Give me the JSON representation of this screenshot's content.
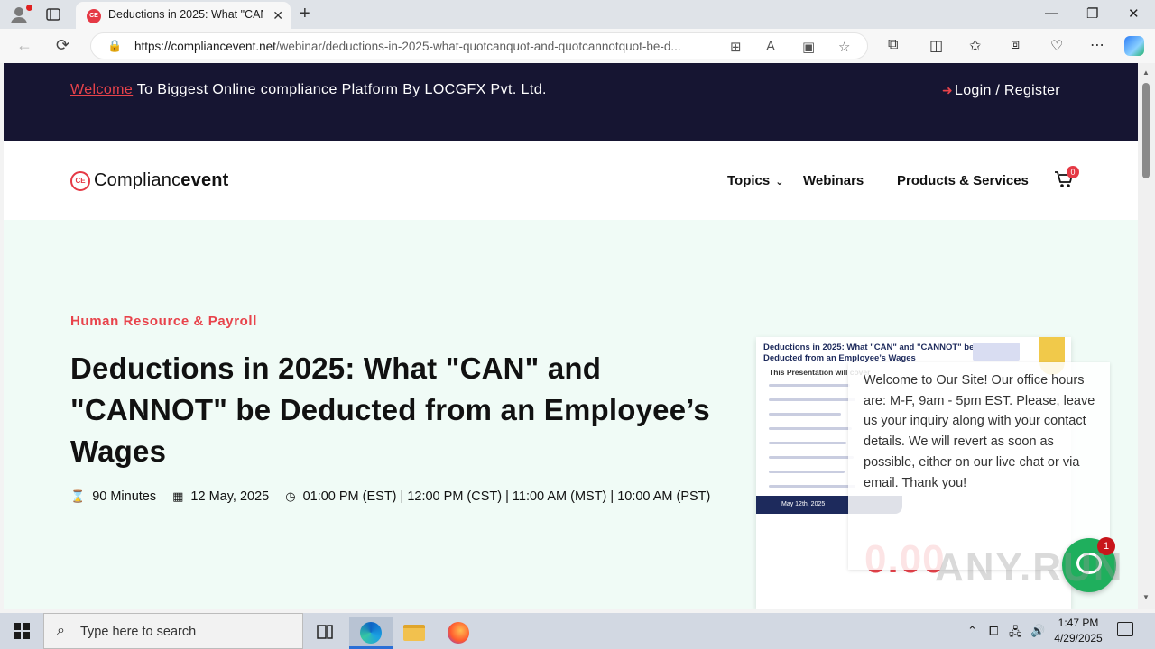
{
  "browser": {
    "tab_title": "Deductions in 2025: What \"CAN\"",
    "tab_close": "✕",
    "new_tab": "+",
    "url_domain": "https://compliancevent.net",
    "url_path": "/webinar/deductions-in-2025-what-quotcanquot-and-quotcannotquot-be-d...",
    "window_controls": {
      "minimize": "—",
      "restore": "❐",
      "close": "✕"
    }
  },
  "topbar": {
    "welcome_link": "Welcome",
    "welcome_text": " To Biggest Online compliance Platform By LOCGFX Pvt. Ltd.",
    "login_label": "Login / Register"
  },
  "header": {
    "logo_light": "Complianc",
    "logo_bold": "event",
    "logo_mark": "CE",
    "nav": [
      {
        "label": "Topics"
      },
      {
        "label": "Webinars"
      },
      {
        "label": "Products & Services"
      }
    ],
    "cart_count": "0"
  },
  "hero": {
    "category": "Human Resource & Payroll",
    "title": "Deductions in 2025: What \"CAN\" and \"CANNOT\" be Deducted from an Employee’s Wages",
    "duration": "90 Minutes",
    "date": "12 May, 2025",
    "time": "01:00 PM (EST) | 12:00 PM (CST) | 11:00 AM (MST) | 10:00 AM (PST)"
  },
  "promo": {
    "title": "Deductions in 2025: What \"CAN\" and \"CANNOT\" be Deducted from an Employee’s Wages",
    "subtitle": "This Presentation will cover",
    "date_strip": "May 12th, 2025",
    "price": "0.00"
  },
  "chat": {
    "message": "Welcome to Our Site! Our office hours are: M-F, 9am - 5pm EST. Please, leave us your inquiry along with your contact details. We will revert as soon as possible, either on our live chat or via email. Thank you!",
    "badge": "1"
  },
  "watermark": "ANY.RUN",
  "taskbar": {
    "search_placeholder": "Type here to search",
    "time": "1:47 PM",
    "date": "4/29/2025"
  },
  "colors": {
    "accent": "#e8434b",
    "topbar_bg": "#161532",
    "hero_bg": "#f0fbf6",
    "chat_green": "#1faf5d"
  }
}
